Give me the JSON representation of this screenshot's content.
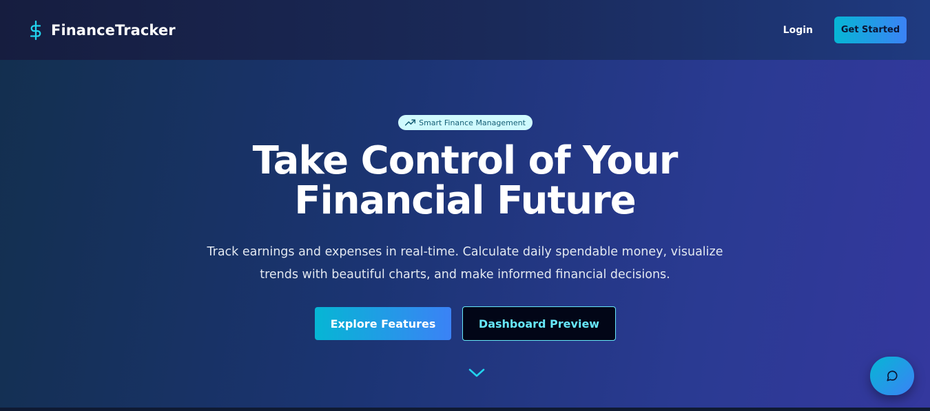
{
  "nav": {
    "brand_name": "FinanceTracker",
    "brand_icon": "dollar-sign-icon",
    "login_label": "Login",
    "get_started_label": "Get Started"
  },
  "hero": {
    "badge_label": "Smart Finance Management",
    "badge_icon": "trending-up-icon",
    "title": "Take Control of Your Financial Future",
    "subtitle": "Track earnings and expenses in real-time. Calculate daily spendable money, visualize trends with beautiful charts, and make informed financial decisions.",
    "explore_label": "Explore Features",
    "dashboard_label": "Dashboard Preview",
    "scroll_icon": "chevron-down-icon"
  },
  "chat": {
    "icon": "message-circle-icon"
  },
  "colors": {
    "accent_cyan": "#06b6d4",
    "accent_blue": "#3b82f6",
    "badge_bg": "#cffafe",
    "outline_cyan": "#67e8f9"
  }
}
